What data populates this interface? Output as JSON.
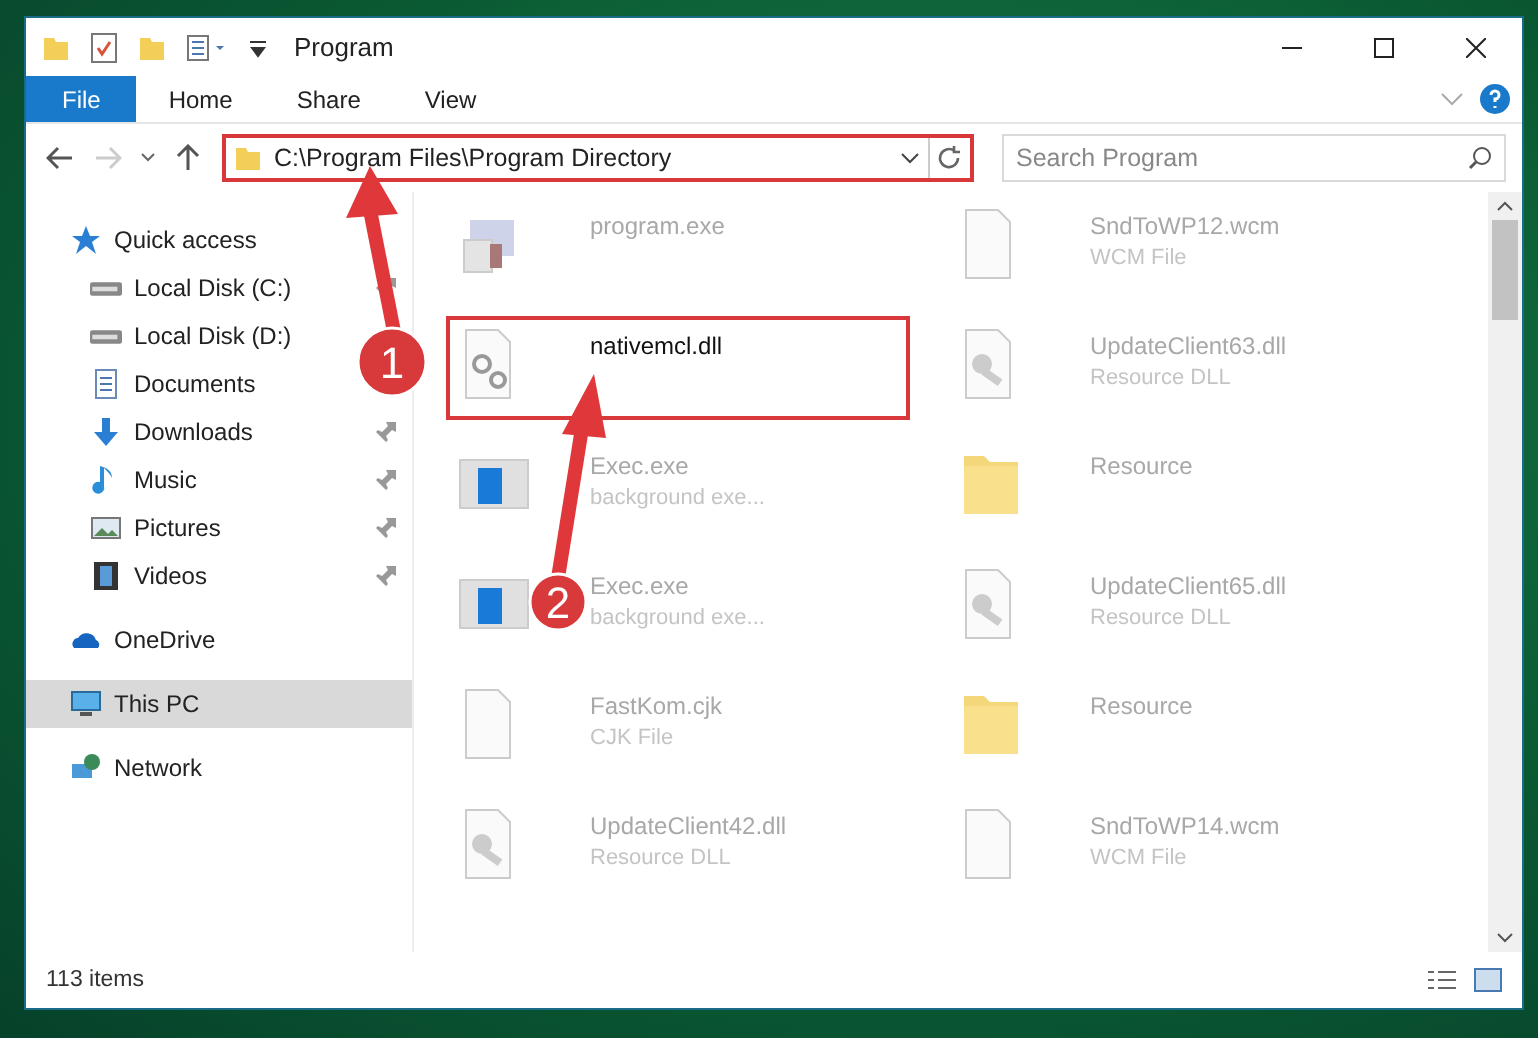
{
  "window": {
    "title": "Program"
  },
  "ribbon": {
    "tabs": [
      {
        "label": "File",
        "kind": "file",
        "selected": false
      },
      {
        "label": "Home",
        "kind": "tab",
        "selected": false
      },
      {
        "label": "Share",
        "kind": "tab",
        "selected": false
      },
      {
        "label": "View",
        "kind": "tab",
        "selected": false
      }
    ]
  },
  "address_bar": {
    "path": "C:\\Program Files\\Program Directory",
    "highlighted": true
  },
  "search": {
    "placeholder": "Search Program"
  },
  "sidebar": {
    "items": [
      {
        "label": "Quick access",
        "kind": "star",
        "selected": false,
        "children": [
          {
            "label": "Local Disk (C:)",
            "kind": "drive",
            "pinned": true,
            "selected": false
          },
          {
            "label": "Local Disk (D:)",
            "kind": "drive",
            "pinned": false,
            "selected": false
          },
          {
            "label": "Documents",
            "kind": "documents",
            "pinned": false,
            "selected": false
          },
          {
            "label": "Downloads",
            "kind": "downloads",
            "pinned": true,
            "selected": false
          },
          {
            "label": "Music",
            "kind": "music",
            "pinned": true,
            "selected": false
          },
          {
            "label": "Pictures",
            "kind": "pictures",
            "pinned": true,
            "selected": false
          },
          {
            "label": "Videos",
            "kind": "videos",
            "pinned": true,
            "selected": false
          }
        ]
      },
      {
        "label": "OneDrive",
        "kind": "cloud",
        "selected": false
      },
      {
        "label": "This PC",
        "kind": "pc",
        "selected": true
      },
      {
        "label": "Network",
        "kind": "network",
        "selected": false
      }
    ]
  },
  "files": [
    {
      "name": "program.exe",
      "kind": "app",
      "highlighted": false
    },
    {
      "name": "SndToWP12.wcm",
      "type": "WCM File",
      "kind": "blank",
      "highlighted": false
    },
    {
      "name": "nativemcl.dll",
      "kind": "gears",
      "highlighted": true
    },
    {
      "name": "UpdateClient63.dll",
      "type": "Resource DLL",
      "kind": "dll",
      "highlighted": false
    },
    {
      "name": "Exec.exe",
      "type": "background exe...",
      "kind": "window",
      "highlighted": false
    },
    {
      "name": "Resource",
      "kind": "folder",
      "highlighted": false
    },
    {
      "name": "Exec.exe",
      "type": "background exe...",
      "kind": "window",
      "highlighted": false
    },
    {
      "name": "UpdateClient65.dll",
      "type": "Resource DLL",
      "kind": "dll",
      "highlighted": false
    },
    {
      "name": "FastKom.cjk",
      "type": "CJK File",
      "kind": "blank",
      "highlighted": false
    },
    {
      "name": "Resource",
      "kind": "folder",
      "highlighted": false
    },
    {
      "name": "UpdateClient42.dll",
      "type": "Resource DLL",
      "kind": "dll",
      "highlighted": false
    },
    {
      "name": "SndToWP14.wcm",
      "type": "WCM File",
      "kind": "blank",
      "highlighted": false
    }
  ],
  "status_bar": {
    "item_count": "113 items"
  },
  "annotations": [
    {
      "label": "1"
    },
    {
      "label": "2"
    }
  ]
}
